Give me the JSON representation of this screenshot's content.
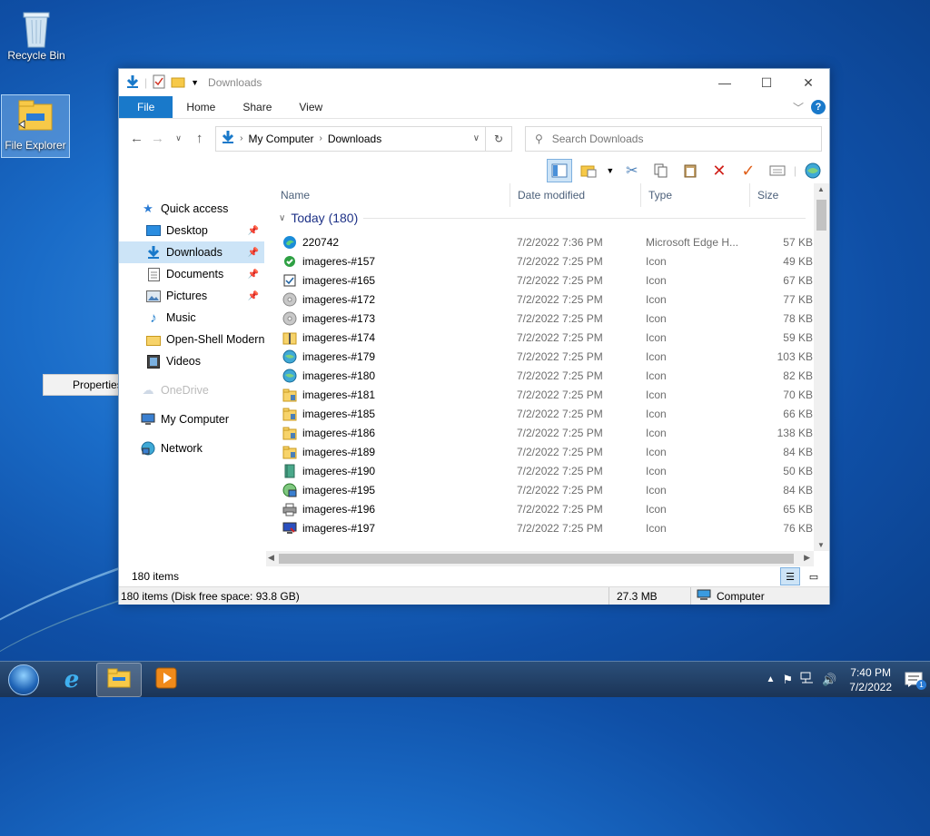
{
  "desktop": {
    "recycle_bin": "Recycle Bin",
    "file_explorer": "File Explorer",
    "context_item": "Properties"
  },
  "window": {
    "title": "Downloads",
    "tabs": [
      "File",
      "Home",
      "Share",
      "View"
    ],
    "address": {
      "root": "My Computer",
      "current": "Downloads"
    },
    "search_placeholder": "Search Downloads"
  },
  "nav": {
    "quick_access": "Quick access",
    "items": [
      "Desktop",
      "Downloads",
      "Documents",
      "Pictures",
      "Music",
      "Open-Shell Modern",
      "Videos"
    ],
    "onedrive": "OneDrive",
    "my_computer": "My Computer",
    "network": "Network"
  },
  "columns": {
    "name": "Name",
    "date": "Date modified",
    "type": "Type",
    "size": "Size"
  },
  "group": "Today (180)",
  "files": [
    {
      "name": "220742",
      "date": "7/2/2022 7:36 PM",
      "type": "Microsoft Edge H...",
      "size": "57 KB",
      "icon": "edge-icon"
    },
    {
      "name": "imageres-#157",
      "date": "7/2/2022 7:25 PM",
      "type": "Icon",
      "size": "49 KB",
      "icon": "green-check-icon"
    },
    {
      "name": "imageres-#165",
      "date": "7/2/2022 7:25 PM",
      "type": "Icon",
      "size": "67 KB",
      "icon": "checkbox-icon"
    },
    {
      "name": "imageres-#172",
      "date": "7/2/2022 7:25 PM",
      "type": "Icon",
      "size": "77 KB",
      "icon": "disc-icon"
    },
    {
      "name": "imageres-#173",
      "date": "7/2/2022 7:25 PM",
      "type": "Icon",
      "size": "78 KB",
      "icon": "disc-icon"
    },
    {
      "name": "imageres-#174",
      "date": "7/2/2022 7:25 PM",
      "type": "Icon",
      "size": "59 KB",
      "icon": "zip-folder-icon"
    },
    {
      "name": "imageres-#179",
      "date": "7/2/2022 7:25 PM",
      "type": "Icon",
      "size": "103 KB",
      "icon": "globe-icon"
    },
    {
      "name": "imageres-#180",
      "date": "7/2/2022 7:25 PM",
      "type": "Icon",
      "size": "82 KB",
      "icon": "globe-icon"
    },
    {
      "name": "imageres-#181",
      "date": "7/2/2022 7:25 PM",
      "type": "Icon",
      "size": "70 KB",
      "icon": "folder-icon"
    },
    {
      "name": "imageres-#185",
      "date": "7/2/2022 7:25 PM",
      "type": "Icon",
      "size": "66 KB",
      "icon": "folder-icon"
    },
    {
      "name": "imageres-#186",
      "date": "7/2/2022 7:25 PM",
      "type": "Icon",
      "size": "138 KB",
      "icon": "folder-icon"
    },
    {
      "name": "imageres-#189",
      "date": "7/2/2022 7:25 PM",
      "type": "Icon",
      "size": "84 KB",
      "icon": "folder-icon"
    },
    {
      "name": "imageres-#190",
      "date": "7/2/2022 7:25 PM",
      "type": "Icon",
      "size": "50 KB",
      "icon": "book-icon"
    },
    {
      "name": "imageres-#195",
      "date": "7/2/2022 7:25 PM",
      "type": "Icon",
      "size": "84 KB",
      "icon": "network-icon"
    },
    {
      "name": "imageres-#196",
      "date": "7/2/2022 7:25 PM",
      "type": "Icon",
      "size": "65 KB",
      "icon": "printer-icon"
    },
    {
      "name": "imageres-#197",
      "date": "7/2/2022 7:25 PM",
      "type": "Icon",
      "size": "76 KB",
      "icon": "monitor-icon"
    }
  ],
  "status": {
    "items_count": "180 items",
    "details_left": "180 items (Disk free space: 93.8 GB)",
    "details_size": "27.3 MB",
    "details_location": "Computer"
  },
  "taskbar": {
    "time": "7:40 PM",
    "date": "7/2/2022",
    "notifications": "1"
  },
  "colors": {
    "accent": "#1979ca",
    "selection": "#cce4f7",
    "group_header": "#1e3287"
  }
}
